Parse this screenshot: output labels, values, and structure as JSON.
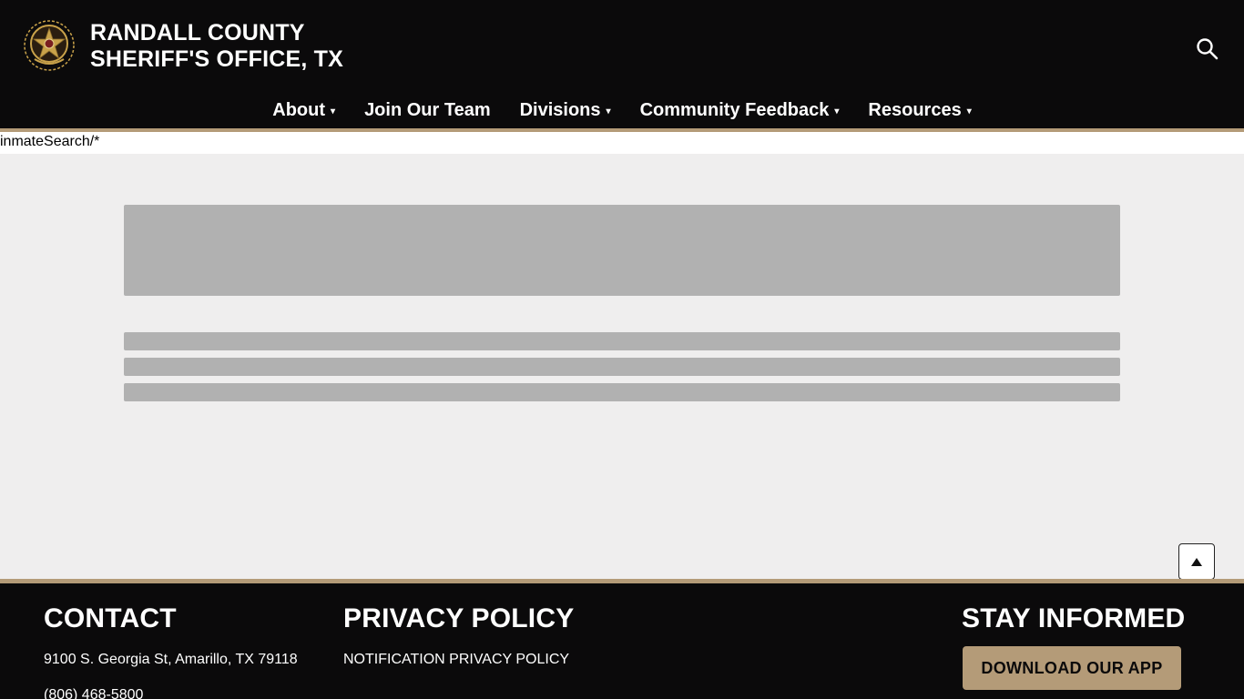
{
  "header": {
    "title_line1": "RANDALL COUNTY",
    "title_line2": "SHERIFF'S OFFICE, TX",
    "logo_icon": "sheriff-star-badge-icon",
    "search_icon": "search-icon"
  },
  "nav": {
    "items": [
      {
        "label": "About",
        "has_dropdown": true
      },
      {
        "label": "Join Our Team",
        "has_dropdown": false
      },
      {
        "label": "Divisions",
        "has_dropdown": true
      },
      {
        "label": "Community Feedback",
        "has_dropdown": true
      },
      {
        "label": "Resources",
        "has_dropdown": true
      }
    ],
    "caret": "▾"
  },
  "path_text": "inmateSearch/*",
  "footer": {
    "contact_heading": "CONTACT",
    "contact_address": "9100 S. Georgia St, Amarillo, TX 79118",
    "contact_phone": "(806) 468-5800",
    "privacy_heading": "PRIVACY POLICY",
    "privacy_link": "NOTIFICATION PRIVACY POLICY",
    "stay_heading": "STAY INFORMED",
    "app_button": "DOWNLOAD OUR APP"
  },
  "colors": {
    "header_bg": "#0b0a0b",
    "accent": "#b49b78",
    "content_bg": "#efeeee",
    "skeleton": "#b1b1b1"
  }
}
